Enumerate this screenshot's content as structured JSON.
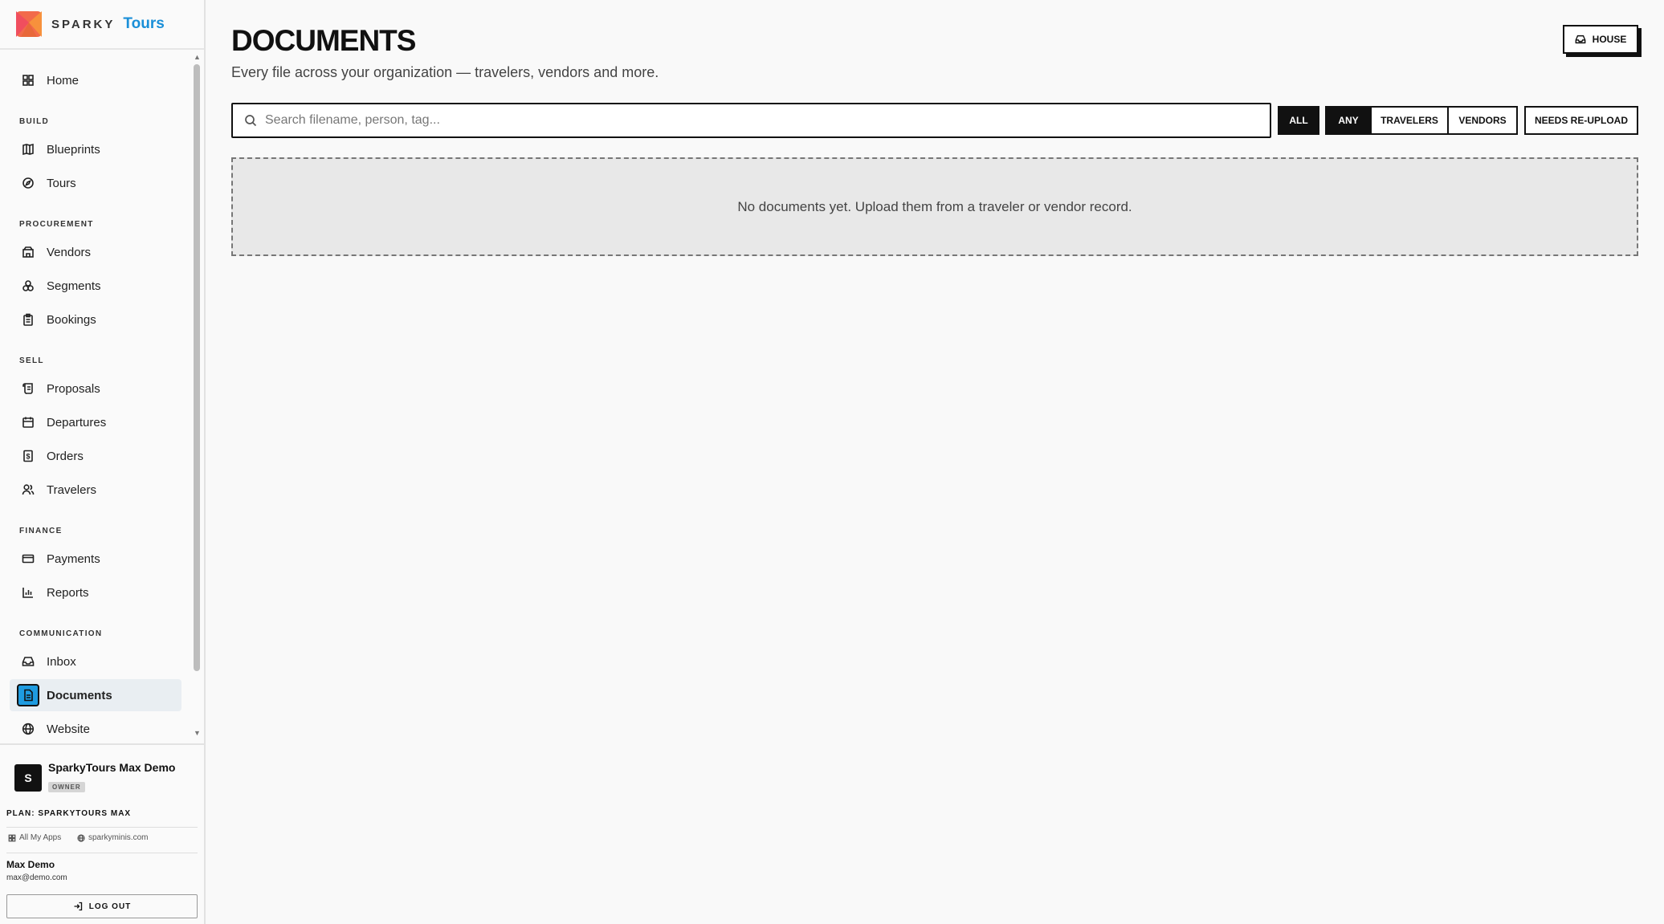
{
  "brand": {
    "sparky": "SPARKY",
    "tours": "Tours"
  },
  "nav": {
    "home": "Home",
    "sections": {
      "build": "BUILD",
      "procurement": "PROCUREMENT",
      "sell": "SELL",
      "finance": "FINANCE",
      "communication": "COMMUNICATION"
    },
    "items": {
      "blueprints": "Blueprints",
      "tours": "Tours",
      "vendors": "Vendors",
      "segments": "Segments",
      "bookings": "Bookings",
      "proposals": "Proposals",
      "departures": "Departures",
      "orders": "Orders",
      "travelers": "Travelers",
      "payments": "Payments",
      "reports": "Reports",
      "inbox": "Inbox",
      "documents": "Documents",
      "website": "Website"
    }
  },
  "account": {
    "avatar_letter": "S",
    "org_name": "SparkyTours Max Demo",
    "role": "OWNER",
    "plan": "PLAN: SPARKYTOURS MAX",
    "all_apps": "All My Apps",
    "site": "sparkyminis.com",
    "user_name": "Max Demo",
    "user_email": "max@demo.com",
    "logout": "LOG OUT"
  },
  "main": {
    "title": "DOCUMENTS",
    "subtitle": "Every file across your organization — travelers, vendors and more.",
    "house_button": "HOUSE",
    "search_placeholder": "Search filename, person, tag...",
    "filters": {
      "all": "ALL",
      "any": "ANY",
      "travelers": "TRAVELERS",
      "vendors": "VENDORS",
      "needs_reupload": "NEEDS RE-UPLOAD"
    },
    "empty_message": "No documents yet. Upload them from a traveler or vendor record."
  },
  "colors": {
    "accent": "#1e9be0",
    "brand_blue": "#1a8fd8",
    "ink": "#111111"
  }
}
